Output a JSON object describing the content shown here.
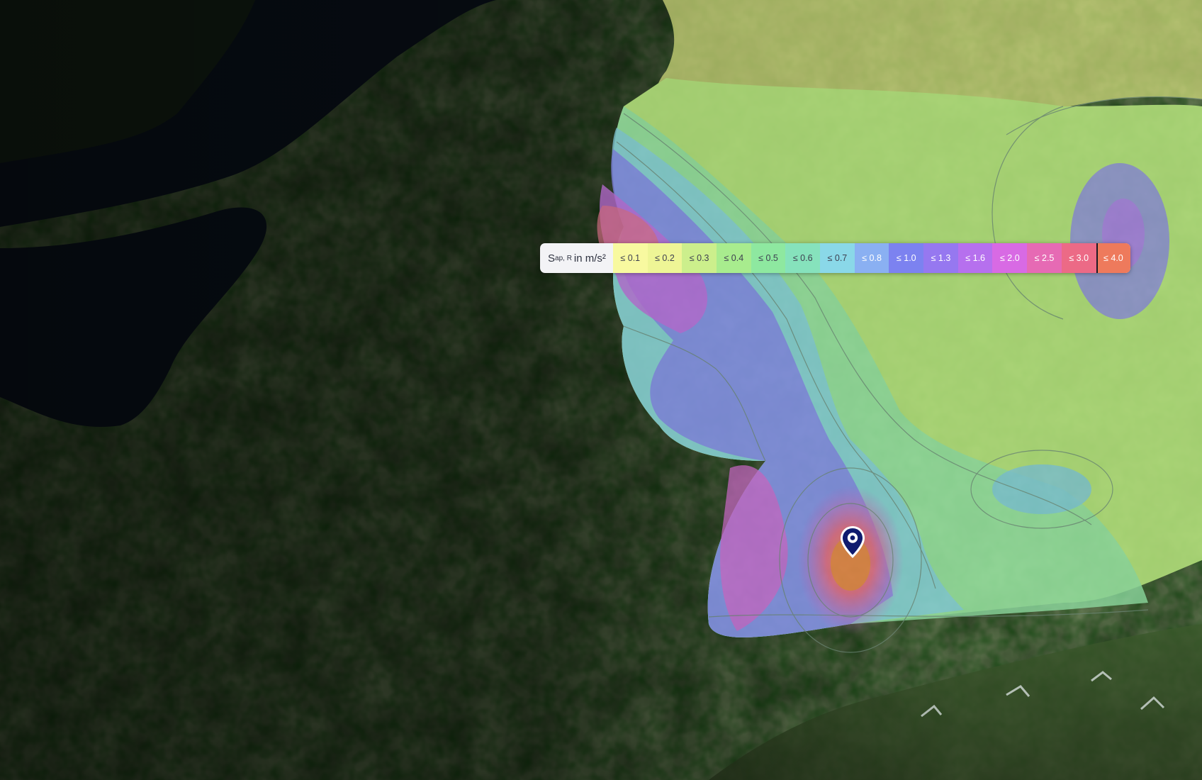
{
  "legend": {
    "title_main": "S",
    "title_sub": "ap, R",
    "title_unit": "in m/s²",
    "items": [
      {
        "label": "≤ 0.1",
        "color": "#f8f9a0"
      },
      {
        "label": "≤ 0.2",
        "color": "#eef596"
      },
      {
        "label": "≤ 0.3",
        "color": "#ccef8c"
      },
      {
        "label": "≤ 0.4",
        "color": "#a8ec8e"
      },
      {
        "label": "≤ 0.5",
        "color": "#8ee8a0"
      },
      {
        "label": "≤ 0.6",
        "color": "#86e2bc"
      },
      {
        "label": "≤ 0.7",
        "color": "#8ad8e8"
      },
      {
        "label": "≤ 0.8",
        "color": "#8ab0f2"
      },
      {
        "label": "≤ 1.0",
        "color": "#7c82f0"
      },
      {
        "label": "≤ 1.3",
        "color": "#9678f0"
      },
      {
        "label": "≤ 1.6",
        "color": "#b670ee"
      },
      {
        "label": "≤ 2.0",
        "color": "#d86ae4"
      },
      {
        "label": "≤ 2.5",
        "color": "#e66ab4"
      },
      {
        "label": "≤ 3.0",
        "color": "#ec6a86"
      },
      {
        "label": "≤ 4.0",
        "color": "#ee7a5c"
      }
    ],
    "selected_index": 14
  },
  "marker": {
    "icon": "map-pin-icon",
    "color": "#0f1b6e"
  }
}
